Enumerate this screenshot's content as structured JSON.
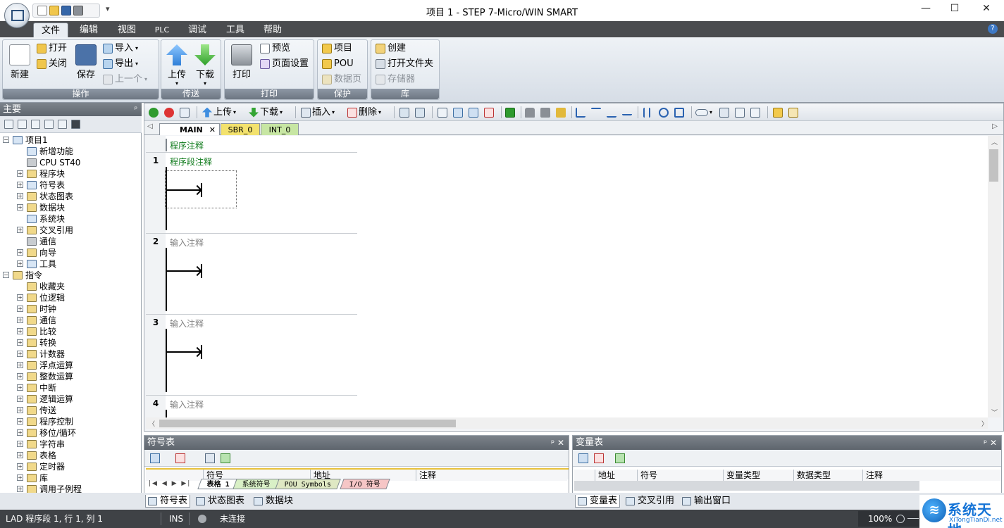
{
  "window": {
    "title": "项目 1 - STEP 7-Micro/WIN SMART",
    "minimize": "—",
    "maximize": "☐",
    "close": "✕"
  },
  "qat": {
    "more": "▾"
  },
  "ribbon_tabs": [
    "文件",
    "编辑",
    "视图",
    "PLC",
    "调试",
    "工具",
    "帮助"
  ],
  "help": "?",
  "ribbon": {
    "ops": {
      "caption": "操作",
      "new": "新建",
      "open": "打开",
      "close": "关闭",
      "save": "保存",
      "import": "导入",
      "export": "导出",
      "prev": "上一个"
    },
    "transfer": {
      "caption": "传送",
      "upload": "上传",
      "download": "下载"
    },
    "print": {
      "caption": "打印",
      "print": "打印",
      "preview": "预览",
      "page_setup": "页面设置"
    },
    "protect": {
      "caption": "保护",
      "project": "项目",
      "pou": "POU",
      "datapage": "数据页"
    },
    "library": {
      "caption": "库",
      "create": "创建",
      "open_folder": "打开文件夹",
      "memory": "存储器"
    }
  },
  "left_panel": {
    "title": "主要",
    "pin": "ᵖ",
    "tree": [
      {
        "label": "项目1",
        "level": 0,
        "exp": "−"
      },
      {
        "label": "新增功能",
        "level": 1,
        "exp": ""
      },
      {
        "label": "CPU ST40",
        "level": 1,
        "exp": ""
      },
      {
        "label": "程序块",
        "level": 1,
        "exp": "+"
      },
      {
        "label": "符号表",
        "level": 1,
        "exp": "+"
      },
      {
        "label": "状态图表",
        "level": 1,
        "exp": "+"
      },
      {
        "label": "数据块",
        "level": 1,
        "exp": "+"
      },
      {
        "label": "系统块",
        "level": 1,
        "exp": ""
      },
      {
        "label": "交叉引用",
        "level": 1,
        "exp": "+"
      },
      {
        "label": "通信",
        "level": 1,
        "exp": ""
      },
      {
        "label": "向导",
        "level": 1,
        "exp": "+"
      },
      {
        "label": "工具",
        "level": 1,
        "exp": "+"
      },
      {
        "label": "指令",
        "level": 0,
        "exp": "−"
      },
      {
        "label": "收藏夹",
        "level": 1,
        "exp": ""
      },
      {
        "label": "位逻辑",
        "level": 1,
        "exp": "+"
      },
      {
        "label": "时钟",
        "level": 1,
        "exp": "+"
      },
      {
        "label": "通信",
        "level": 1,
        "exp": "+"
      },
      {
        "label": "比较",
        "level": 1,
        "exp": "+"
      },
      {
        "label": "转换",
        "level": 1,
        "exp": "+"
      },
      {
        "label": "计数器",
        "level": 1,
        "exp": "+"
      },
      {
        "label": "浮点运算",
        "level": 1,
        "exp": "+"
      },
      {
        "label": "整数运算",
        "level": 1,
        "exp": "+"
      },
      {
        "label": "中断",
        "level": 1,
        "exp": "+"
      },
      {
        "label": "逻辑运算",
        "level": 1,
        "exp": "+"
      },
      {
        "label": "传送",
        "level": 1,
        "exp": "+"
      },
      {
        "label": "程序控制",
        "level": 1,
        "exp": "+"
      },
      {
        "label": "移位/循环",
        "level": 1,
        "exp": "+"
      },
      {
        "label": "字符串",
        "level": 1,
        "exp": "+"
      },
      {
        "label": "表格",
        "level": 1,
        "exp": "+"
      },
      {
        "label": "定时器",
        "level": 1,
        "exp": "+"
      },
      {
        "label": "库",
        "level": 1,
        "exp": "+"
      },
      {
        "label": "调用子例程",
        "level": 1,
        "exp": "+"
      }
    ]
  },
  "editor_toolbar": {
    "upload": "上传",
    "download": "下载",
    "insert": "插入",
    "delete": "删除"
  },
  "pou_tabs": {
    "main": "MAIN",
    "main_close": "✕",
    "sbr": "SBR_0",
    "int": "INT_0",
    "left": "◁",
    "right": "▷"
  },
  "ladder": {
    "program_comment": "程序注释",
    "rungs": [
      {
        "num": "1",
        "comment": "程序段注释"
      },
      {
        "num": "2",
        "comment": "输入注释"
      },
      {
        "num": "3",
        "comment": "输入注释"
      },
      {
        "num": "4",
        "comment": "输入注释"
      }
    ]
  },
  "symbol_panel": {
    "title": "符号表",
    "controls": "ᵖ  ✕",
    "columns": [
      "符号",
      "地址",
      "注释"
    ],
    "nav": "|◀ ◀ ▶ ▶|",
    "tabs": [
      "表格 1",
      "系统符号",
      "POU Symbols",
      "I/O 符号"
    ]
  },
  "variable_panel": {
    "title": "变量表",
    "controls": "ᵖ  ✕",
    "columns": [
      "地址",
      "符号",
      "变量类型",
      "数据类型",
      "注释"
    ]
  },
  "bottom_tabs_left": [
    "符号表",
    "状态图表",
    "数据块"
  ],
  "bottom_tabs_right": [
    "变量表",
    "交叉引用",
    "输出窗口"
  ],
  "status": {
    "position": "LAD 程序段 1, 行 1, 列 1",
    "mode": "INS",
    "connection": "未连接",
    "zoom": "100%"
  },
  "watermark": {
    "logo": "≋",
    "text": "系统天地",
    "sub": "XiTongTianDi.net"
  },
  "colors": {
    "accent": "#3d78c4",
    "comment_green": "#0d7a1a",
    "tab_main": "#ffffff",
    "tab_sbr": "#f3e26d",
    "tab_int": "#c7e6a3"
  }
}
